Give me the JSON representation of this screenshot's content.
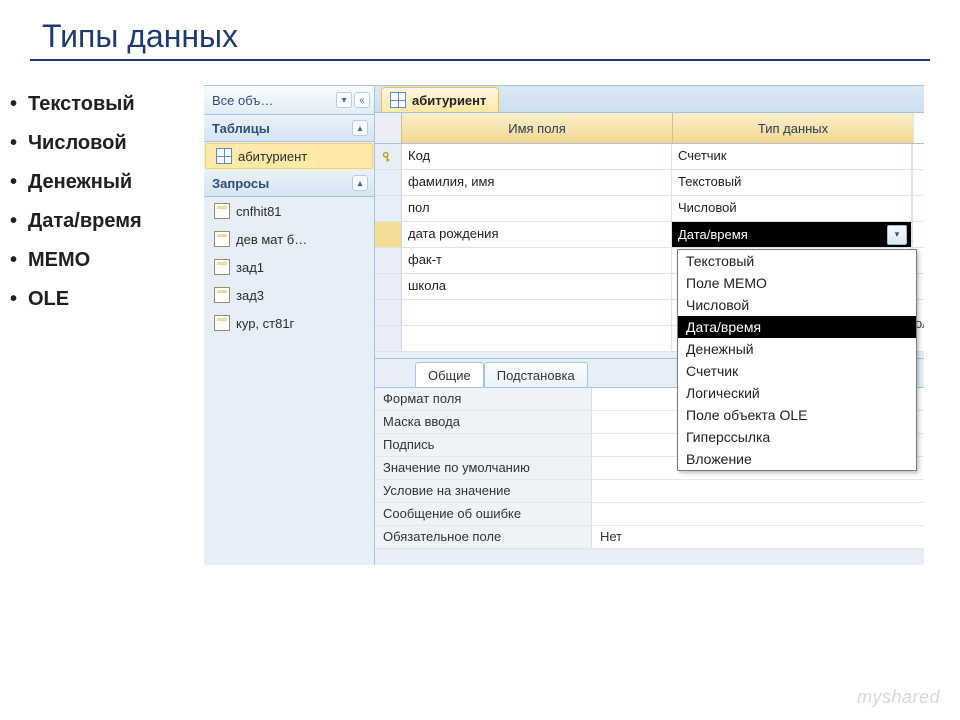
{
  "slide": {
    "title": "Типы данных",
    "bullets": [
      "Текстовый",
      "Числовой",
      "Денежный",
      "Дата/время",
      "MEMO",
      "OLE"
    ]
  },
  "nav": {
    "top_label": "Все объ…",
    "tables_header": "Таблицы",
    "queries_header": "Запросы",
    "table_item": "абитуриент",
    "queries": [
      "cnfhit81",
      "дев мат б…",
      "зад1",
      "зад3",
      "кур, ст81г"
    ]
  },
  "doc_tab": "абитуриент",
  "grid": {
    "col_name": "Имя поля",
    "col_type": "Тип данных",
    "rows": [
      {
        "name": "Код",
        "type": "Счетчик",
        "pk": true
      },
      {
        "name": "фамилия, имя",
        "type": "Текстовый",
        "pk": false
      },
      {
        "name": "пол",
        "type": "Числовой",
        "pk": false
      },
      {
        "name": "дата рождения",
        "type": "Дата/время",
        "pk": false,
        "selected": true
      },
      {
        "name": "фак-т",
        "type": "",
        "pk": false
      },
      {
        "name": "школа",
        "type": "",
        "pk": false
      }
    ]
  },
  "behind_label": "оля",
  "dropdown": {
    "items": [
      "Текстовый",
      "Поле МЕМО",
      "Числовой",
      "Дата/время",
      "Денежный",
      "Счетчик",
      "Логический",
      "Поле объекта OLE",
      "Гиперссылка",
      "Вложение"
    ],
    "selected": "Дата/время"
  },
  "props": {
    "tab_general": "Общие",
    "tab_lookup": "Подстановка",
    "rows": [
      {
        "label": "Формат поля",
        "value": ""
      },
      {
        "label": "Маска ввода",
        "value": ""
      },
      {
        "label": "Подпись",
        "value": ""
      },
      {
        "label": "Значение по умолчанию",
        "value": ""
      },
      {
        "label": "Условие на значение",
        "value": ""
      },
      {
        "label": "Сообщение об ошибке",
        "value": ""
      },
      {
        "label": "Обязательное поле",
        "value": "Нет"
      }
    ]
  },
  "watermark": "myshared"
}
